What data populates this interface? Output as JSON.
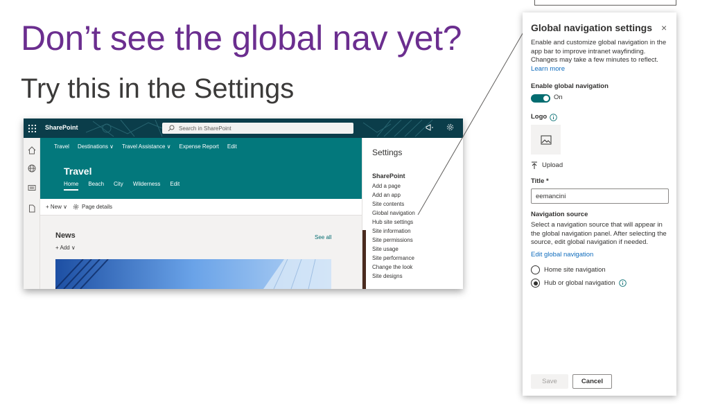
{
  "slide": {
    "headline": "Don’t see the global nav yet?",
    "subhead": "Try this in the Settings"
  },
  "sharepoint": {
    "brand": "SharePoint",
    "search_placeholder": "Search in SharePoint",
    "hub_nav": [
      "Travel",
      "Destinations ∨",
      "Travel Assistance ∨",
      "Expense Report",
      "Edit"
    ],
    "site_title": "Travel",
    "site_nav": [
      "Home",
      "Beach",
      "City",
      "Wilderness",
      "Edit"
    ],
    "command_bar": {
      "new_label": "+ New ∨",
      "page_details_label": "Page details"
    },
    "news": {
      "title": "News",
      "add_label": "+ Add ∨",
      "see_all_label": "See all"
    },
    "settings": {
      "title": "Settings",
      "section": "SharePoint",
      "items": [
        "Add a page",
        "Add an app",
        "Site contents",
        "Global navigation",
        "Hub site settings",
        "Site information",
        "Site permissions",
        "Site usage",
        "Site performance",
        "Change the look",
        "Site designs"
      ]
    }
  },
  "panel": {
    "title": "Global navigation settings",
    "close_icon": "×",
    "description": "Enable and customize global navigation in the app bar to improve intranet wayfinding. Changes may take a few minutes to reflect.",
    "learn_more": "Learn more",
    "enable_label": "Enable global navigation",
    "toggle_state": "On",
    "logo_label": "Logo",
    "upload_label": "Upload",
    "title_label": "Title *",
    "title_value": "eemancini",
    "nav_source_label": "Navigation source",
    "nav_source_desc": "Select a navigation source that will appear in the global navigation panel. After selecting the source, edit global navigation if needed.",
    "edit_link": "Edit global navigation",
    "options": [
      {
        "label": "Home site navigation",
        "selected": false
      },
      {
        "label": "Hub or global navigation",
        "selected": true
      }
    ],
    "save_label": "Save",
    "cancel_label": "Cancel"
  },
  "colors": {
    "headline": "#6b2e8f",
    "suite_bar": "#0b3d4a",
    "site_theme": "#03787c",
    "toggle_on": "#036c70",
    "link": "#0f6cbd"
  }
}
